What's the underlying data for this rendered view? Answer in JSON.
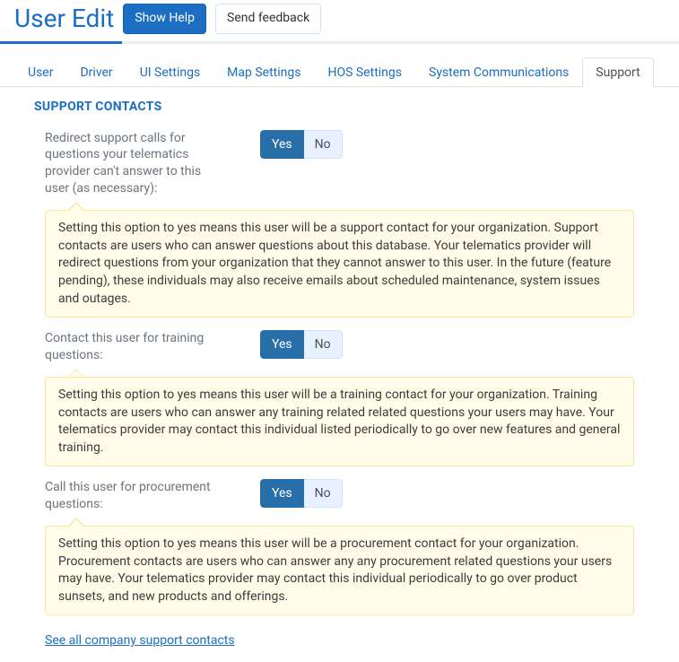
{
  "header": {
    "title": "User Edit",
    "show_help_label": "Show Help",
    "send_feedback_label": "Send feedback"
  },
  "tabs": [
    {
      "label": "User",
      "active": false
    },
    {
      "label": "Driver",
      "active": false
    },
    {
      "label": "UI Settings",
      "active": false
    },
    {
      "label": "Map Settings",
      "active": false
    },
    {
      "label": "HOS Settings",
      "active": false
    },
    {
      "label": "System Communications",
      "active": false
    },
    {
      "label": "Support",
      "active": true
    }
  ],
  "section": {
    "title": "SUPPORT CONTACTS"
  },
  "toggle": {
    "yes": "Yes",
    "no": "No"
  },
  "options": [
    {
      "name": "redirect-support-calls",
      "label": "Redirect support calls for questions your telematics provider can't answer to this user (as necessary):",
      "value": "Yes",
      "help": "Setting this option to yes means this user will be a support contact for your organization. Support contacts are users who can answer questions about this database. Your telematics provider will redirect questions from your organization that they cannot answer to this user. In the future (feature pending), these individuals may also receive emails about scheduled maintenance, system issues and outages."
    },
    {
      "name": "training-contact",
      "label": "Contact this user for training questions:",
      "value": "Yes",
      "help": "Setting this option to yes means this user will be a training contact for your organization. Training contacts are users who can answer any training related related questions your users may have. Your telematics provider may contact this individual listed periodically to go over new features and general training."
    },
    {
      "name": "procurement-contact",
      "label": "Call this user for procurement questions:",
      "value": "Yes",
      "help": "Setting this option to yes means this user will be a procurement contact for your organization. Procurement contacts are users who can answer any any procurement related questions your users may have. Your telematics provider may contact this individual periodically to go over product sunsets, and new products and offerings."
    }
  ],
  "footer_link": {
    "label": "See all company support contacts"
  }
}
